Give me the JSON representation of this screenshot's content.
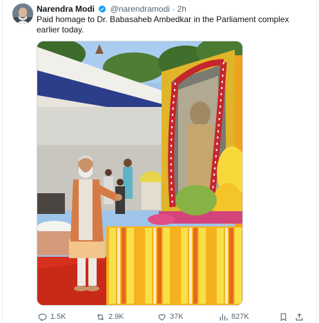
{
  "tweet": {
    "author_name": "Narendra Modi",
    "author_handle": "@narendramodi",
    "separator": "·",
    "time": "2h",
    "text": "Paid homage to Dr. Babasaheb Ambedkar in the Parliament complex earlier today."
  },
  "actions": {
    "replies": "1.5K",
    "reposts": "2.9K",
    "likes": "37K",
    "views": "827K"
  },
  "icons": {
    "verified": "verified-badge-icon",
    "reply": "reply-icon",
    "repost": "repost-icon",
    "like": "heart-icon",
    "views": "views-bar-chart-icon",
    "bookmark": "bookmark-icon",
    "share": "share-icon"
  },
  "colors": {
    "text_primary": "#0f1419",
    "text_secondary": "#536471",
    "verified_blue": "#1d9bf0",
    "border": "#cfd9de"
  }
}
